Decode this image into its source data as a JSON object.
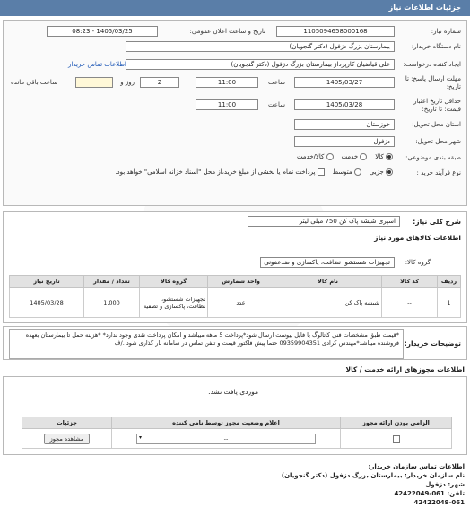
{
  "header": {
    "title": "جزئیات اطلاعات نیاز"
  },
  "form": {
    "need_number_label": "شماره نیاز:",
    "need_number": "1105094658000168",
    "announce_label": "تاریخ و ساعت اعلان عمومی:",
    "announce_value": "1405/03/25 - 08:23",
    "buyer_label": "نام دستگاه خریدار:",
    "buyer_value": "بیمارستان بزرگ دزفول (دکتر گنجویان)",
    "creator_label": "ایجاد کننده درخواست:",
    "creator_value": "علی قیاضیان کارپرداز بیمارستان بزرگ دزفول (دکتر گنجویان)",
    "contact_link": "اطلاعات تماس خریدار",
    "deadline_label_1": "مهلت ارسال پاسخ: تا",
    "deadline_label_2": "تاریخ:",
    "deadline_date": "1405/03/27",
    "time_label": "ساعت",
    "deadline_time": "11:00",
    "days_value": "2",
    "days_label": "روز و",
    "remaining_label": "ساعت باقی مانده",
    "validity_label_1": "حداقل تاریخ اعتبار",
    "validity_label_2": "قیمت: تا تاریخ:",
    "validity_date": "1405/03/28",
    "validity_time": "11:00",
    "province_label": "استان محل تحویل:",
    "province_value": "خوزستان",
    "city_label": "شهر محل تحویل:",
    "city_value": "دزفول",
    "category_label": "طبقه بندی موضوعی:",
    "cat_goods": "کالا",
    "cat_service": "خدمت",
    "cat_goods_service": "کالا/خدمت",
    "process_label": "نوع فرآیند خرید :",
    "proc_small": "جزیی",
    "proc_medium": "متوسط",
    "payment_text": "پرداخت تمام یا بخشی از مبلغ خرید،از محل \"اسناد خزانه اسلامی\" خواهد بود."
  },
  "summary": {
    "label": "شرح کلی نیاز:",
    "value": "اسپری شیشه پاک کن 750 میلی لیتر"
  },
  "goods": {
    "title": "اطلاعات کالاهای مورد نیاز",
    "group_label": "گروه کالا:",
    "group_value": "تجهیزات شستشو، نظافت، پاکسازی و ضدعفونی",
    "headers": [
      "ردیف",
      "کد کالا",
      "نام کالا",
      "واحد شمارش",
      "گروه کالا",
      "تعداد / مقدار",
      "تاریخ نیاز"
    ],
    "row": {
      "index": "1",
      "code": "--",
      "name": "شیشه پاک کن",
      "unit": "عدد",
      "group": "تجهیزات شستشو، نظافت، پاکسازی و تصفیه",
      "qty": "1,000",
      "date": "1405/03/28"
    }
  },
  "notes": {
    "label": "توضیحات خریدار:",
    "text": "*قیمت طبق مشخصات فنی کاتالوگ یا فایل پیوست ارسال شود*پرداخت 5 ماهه میباشد و امکان پرداخت نقدی وجود ندارد* *هزینه حمل تا بیمارستان بعهده فروشنده میباشد*مهندس کرادی 09359904351 حتما پیش فاکتور قیمت و تلفن تماس در سامانه بار گذاری شود ./ف"
  },
  "licenses": {
    "title": "اطلاعات مجوزهای ارائه خدمت / کالا",
    "not_found_label": "موردی",
    "not_found_word": "یافت نشد.",
    "headers": [
      "الزامی بودن ارائه مجوز",
      "اعلام وضعیت مجوز توسط نامی کننده",
      "جزئیات"
    ],
    "select_value": "--",
    "view_button": "مشاهده مجوز"
  },
  "buyer_contact": {
    "title": "اطلاعات تماس سازمان خریدار:",
    "org": "نام سازمان خریدار: بیمارستان بزرگ دزفول (دکتر گنجویان)",
    "city": "شهر: دزفول",
    "tel1": "تلفن: 061-42422049",
    "tel2": "42422049-061"
  }
}
